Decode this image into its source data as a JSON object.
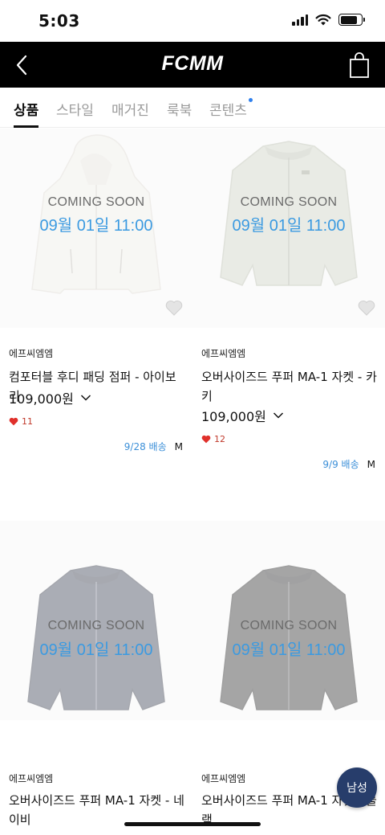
{
  "status_bar": {
    "time": "5:03"
  },
  "header": {
    "brand": "FCMM"
  },
  "tabs": [
    {
      "label": "상품",
      "active": true
    },
    {
      "label": "스타일",
      "active": false
    },
    {
      "label": "매거진",
      "active": false
    },
    {
      "label": "룩북",
      "active": false
    },
    {
      "label": "콘텐츠",
      "active": false,
      "has_new_dot": true
    }
  ],
  "products": [
    {
      "coming_soon": "COMING SOON",
      "release": "09월 01일 11:00",
      "brand": "에프씨엠엠",
      "name": "컴포터블 후디 패딩 점퍼 - 아이보리",
      "price": "109,000원",
      "likes": "11",
      "delivery_date": "9/28 배송",
      "size": "M",
      "image": "ivory-hooded-padding-jumper"
    },
    {
      "coming_soon": "COMING SOON",
      "release": "09월 01일 11:00",
      "brand": "에프씨엠엠",
      "name": "오버사이즈드 푸퍼 MA-1 자켓 - 카키",
      "price": "109,000원",
      "likes": "12",
      "delivery_date": "9/9 배송",
      "size": "M",
      "image": "khaki-ma1-jacket"
    },
    {
      "coming_soon": "COMING SOON",
      "release": "09월 01일 11:00",
      "brand": "에프씨엠엠",
      "name": "오버사이즈드 푸퍼 MA-1 자켓 - 네이비",
      "image": "navy-ma1-jacket"
    },
    {
      "coming_soon": "COMING SOON",
      "release": "09월 01일 11:00",
      "brand": "에프씨엠엠",
      "name": "오버사이즈드 푸퍼 MA-1 자켓 - 블랙",
      "image": "black-ma1-jacket"
    }
  ],
  "fab": {
    "label": "남성"
  },
  "colors": {
    "header_bg": "#000000",
    "release_blue": "#3b9ae1",
    "like_red": "#e0302b",
    "fab_navy": "#273d6b"
  }
}
